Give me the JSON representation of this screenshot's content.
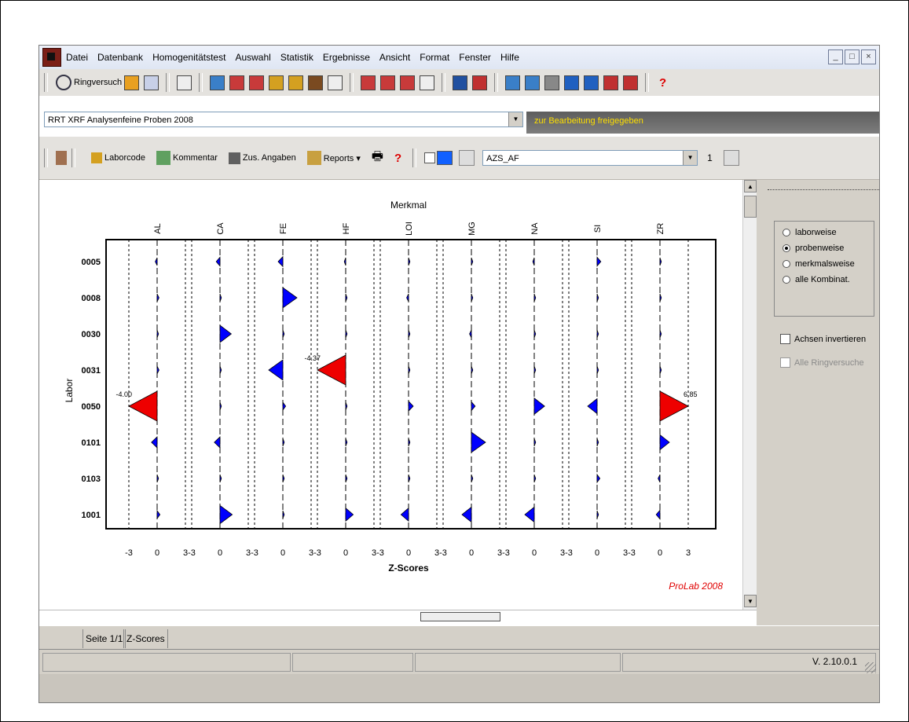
{
  "menu": [
    "Datei",
    "Datenbank",
    "Homogenitätstest",
    "Auswahl",
    "Statistik",
    "Ergebnisse",
    "Ansicht",
    "Format",
    "Fenster",
    "Hilfe"
  ],
  "window_controls": {
    "minimize": "_",
    "maximize": "□",
    "close": "×"
  },
  "toolbar1": {
    "ringversuch_label": "Ringversuch"
  },
  "ringversuch_select": {
    "value": "RRT XRF Analysenfeine Proben 2008",
    "status": "zur Bearbeitung freigegeben"
  },
  "toolbar2": {
    "laborcode": "Laborcode",
    "kommentar": "Kommentar",
    "zus_angaben": "Zus. Angaben",
    "reports": "Reports ▾",
    "help": "?",
    "small_value": "1",
    "feature_select": "AZS_AF"
  },
  "right_panel": {
    "options": [
      {
        "label": "laborweise",
        "checked": false
      },
      {
        "label": "probenweise",
        "checked": true
      },
      {
        "label": "merkmalsweise",
        "checked": false
      },
      {
        "label": "alle Kombinat.",
        "checked": false
      }
    ],
    "achsen": "Achsen invertieren",
    "alle_ringversuche": "Alle Ringversuche"
  },
  "tabs": {
    "seite": "Seite 1/1",
    "zscores": "Z-Scores"
  },
  "status": {
    "version": "V. 2.10.0.1"
  },
  "colors": {
    "blue": "#0000ff",
    "yellow": "#f5f000",
    "red": "#ee0000",
    "accent_status": "#ffe000"
  },
  "chart_data": {
    "type": "scatter",
    "title": "Merkmal",
    "xlabel": "Z-Scores",
    "ylabel": "Labor",
    "footer": "ProLab 2008",
    "features": [
      "AL",
      "CA",
      "FE",
      "HF",
      "LOI",
      "MG",
      "NA",
      "SI",
      "ZR"
    ],
    "labs": [
      "0005",
      "0008",
      "0030",
      "0031",
      "0050",
      "0101",
      "0103",
      "1001"
    ],
    "xlim": [
      -3,
      3
    ],
    "xticks": [
      "-3",
      "0",
      "3"
    ],
    "values": [
      [
        -0.2,
        -0.4,
        -0.5,
        -0.1,
        0.1,
        0.0,
        -0.1,
        0.4,
        0.1
      ],
      [
        0.2,
        0.0,
        1.5,
        0.0,
        -0.2,
        0.0,
        0.1,
        0.1,
        0.1
      ],
      [
        0.0,
        1.2,
        0.1,
        0.0,
        0.0,
        -0.2,
        0.0,
        0.0,
        0.0
      ],
      [
        0.2,
        0.0,
        -1.5,
        -4.37,
        0.1,
        0.0,
        0.1,
        0.1,
        0.1
      ],
      [
        -4.0,
        0.0,
        0.3,
        0.0,
        0.5,
        0.4,
        1.1,
        -1.0,
        6.85
      ],
      [
        -0.6,
        -0.6,
        0.0,
        0.1,
        0.1,
        1.5,
        0.1,
        0.0,
        1.0
      ],
      [
        0.0,
        0.0,
        0.0,
        0.0,
        0.0,
        0.0,
        0.1,
        0.3,
        -0.2
      ],
      [
        0.3,
        1.3,
        0.1,
        0.8,
        -0.8,
        -1.0,
        -1.0,
        0.1,
        -0.4
      ]
    ],
    "value_labels": [
      {
        "lab": "0050",
        "feature": "AL",
        "text": "-4.00"
      },
      {
        "lab": "0031",
        "feature": "HF",
        "text": "-4.37"
      },
      {
        "lab": "0050",
        "feature": "ZR",
        "text": "6.85"
      }
    ],
    "color_rule": {
      "blue_below": 2,
      "yellow_below": 3,
      "red_from": 3
    }
  }
}
